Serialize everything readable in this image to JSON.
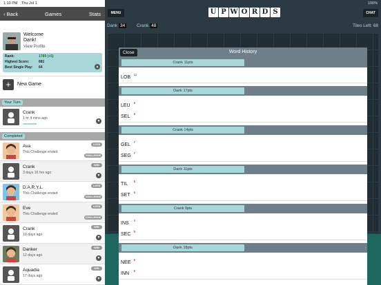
{
  "status": {
    "time": "1:10 PM",
    "date": "Thu Jul 1",
    "battery": "100%"
  },
  "nav": {
    "back": "Back",
    "title": "Games",
    "stats": "Stats"
  },
  "profile": {
    "welcome": "Welcome",
    "name": "Dank!",
    "view": "View Profile",
    "stats": [
      {
        "label": "Rank:",
        "value": "1789 (+5)"
      },
      {
        "label": "Highest Score:",
        "value": "681"
      },
      {
        "label": "Best Single Play:",
        "value": "64"
      }
    ]
  },
  "new_game": "New Game",
  "your_turn": "Your Turn",
  "completed": "Completed",
  "turn_game": {
    "name": "Crank",
    "time": "1 hr 4 mins ago"
  },
  "games": [
    {
      "name": "Ava",
      "sub": "This Challenge ended",
      "result": "LOSS",
      "action": "CHALLENGE"
    },
    {
      "name": "Crank",
      "sub": "3 days 16 hrs ago",
      "result": "WIN",
      "action": ""
    },
    {
      "name": "D.A.R.Y.L.",
      "sub": "This Challenge ended",
      "result": "LOSS",
      "action": "CHALLENGE"
    },
    {
      "name": "Eve",
      "sub": "This Challenge ended",
      "result": "LOSS",
      "action": "CHALLENGE"
    },
    {
      "name": "Crank",
      "sub": "10 days ago",
      "result": "WIN",
      "action": ""
    },
    {
      "name": "Danker",
      "sub": "12 days ago",
      "result": "WIN",
      "action": ""
    },
    {
      "name": "Aquadia",
      "sub": "17 days ago",
      "result": "WIN",
      "action": ""
    }
  ],
  "board": {
    "menu": "MENU",
    "chat": "CHAT",
    "logo": [
      "U",
      "P",
      "W",
      "O",
      "R",
      "D",
      "S"
    ],
    "p1": "Dank",
    "p1_score": "34",
    "p2": "Crank",
    "p2_score": "48",
    "tiles_left": "Tiles Left: 68"
  },
  "modal": {
    "close": "Close",
    "title": "Word History",
    "groups": [
      {
        "label": "Crank 11pts",
        "words": [
          {
            "w": "LOB",
            "p": "11"
          }
        ]
      },
      {
        "label": "Dank 17pts",
        "words": [
          {
            "w": "LEU",
            "p": "9"
          },
          {
            "w": "SEL",
            "p": "8"
          }
        ]
      },
      {
        "label": "Crank 14pts",
        "words": [
          {
            "w": "GEL",
            "p": "7"
          },
          {
            "w": "SEG",
            "p": "7"
          }
        ]
      },
      {
        "label": "Dank 11pts",
        "words": [
          {
            "w": "TIL",
            "p": "5"
          },
          {
            "w": "SET",
            "p": "6"
          }
        ]
      },
      {
        "label": "Crank 9pts",
        "words": [
          {
            "w": "INS",
            "p": "4"
          },
          {
            "w": "SEC",
            "p": "5"
          }
        ]
      },
      {
        "label": "Dank 18pts",
        "words": [
          {
            "w": "NEE",
            "p": "6"
          },
          {
            "w": "INN",
            "p": "6"
          }
        ]
      }
    ]
  },
  "colors": {
    "accent": "#a7d7d9",
    "header": "#4b4b4b",
    "modal_header": "#6f7f8a",
    "board": "#2c3a44",
    "points": "#cc0000"
  }
}
